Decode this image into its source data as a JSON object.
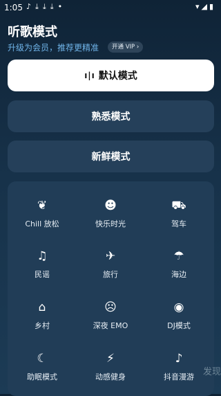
{
  "status": {
    "time": "1:05",
    "left_icons": [
      "music-note-icon",
      "download-icon",
      "download-icon",
      "download-icon",
      "dot-icon"
    ],
    "right_icons": [
      "wifi-icon",
      "signal-icon",
      "battery-icon"
    ]
  },
  "header": {
    "title": "听歌模式",
    "subtitle": "升级为会员，推荐更精准",
    "vip_label": "开通 VIP"
  },
  "modes": {
    "default_label": "默认模式",
    "familiar_label": "熟悉模式",
    "new_label": "新鲜模式"
  },
  "scenes": [
    {
      "label": "Chill 放松",
      "icon": "leaf-icon"
    },
    {
      "label": "快乐时光",
      "icon": "smile-icon"
    },
    {
      "label": "驾车",
      "icon": "car-icon"
    },
    {
      "label": "民谣",
      "icon": "guitar-icon"
    },
    {
      "label": "旅行",
      "icon": "walking-icon"
    },
    {
      "label": "海边",
      "icon": "beach-icon"
    },
    {
      "label": "乡村",
      "icon": "house-icon"
    },
    {
      "label": "深夜 EMO",
      "icon": "sad-face-icon"
    },
    {
      "label": "DJ模式",
      "icon": "dj-icon"
    },
    {
      "label": "助眠模式",
      "icon": "moon-icon"
    },
    {
      "label": "动感健身",
      "icon": "running-icon"
    },
    {
      "label": "抖音漫游",
      "icon": "tiktok-icon"
    }
  ],
  "side_tab_label": "发现"
}
